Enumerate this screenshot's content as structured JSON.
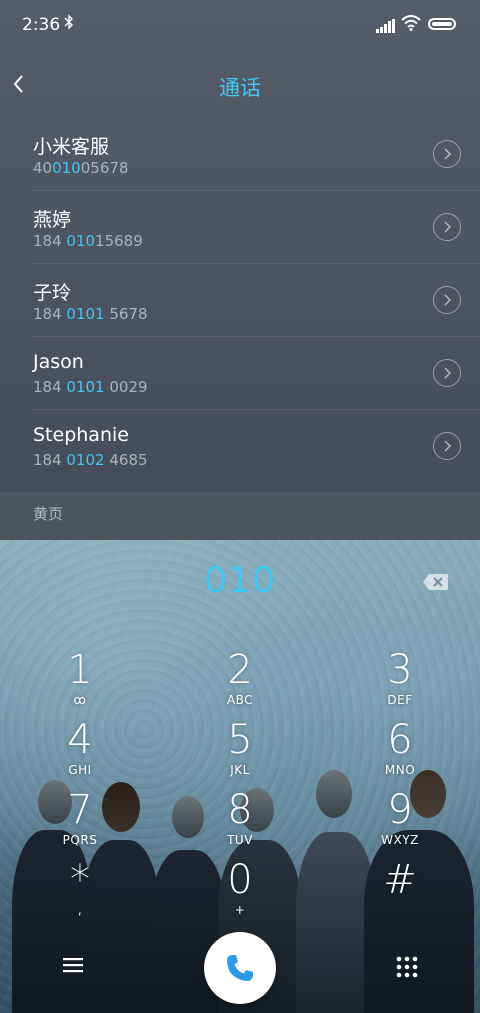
{
  "status": {
    "time": "2:36"
  },
  "header": {
    "title": "通话"
  },
  "contacts": [
    {
      "name": "小米客服",
      "num_pre": "40",
      "num_hl": "010",
      "num_post": "05678"
    },
    {
      "name": "燕婷",
      "num_pre": "184 ",
      "num_hl": "010",
      "num_post": "15689"
    },
    {
      "name": "子玲",
      "num_pre": "184 ",
      "num_hl": "0101",
      "num_post": " 5678"
    },
    {
      "name": "Jason",
      "num_pre": "184 ",
      "num_hl": "0101",
      "num_post": " 0029"
    },
    {
      "name": "Stephanie",
      "num_pre": "184 ",
      "num_hl": "0102",
      "num_post": " 4685"
    }
  ],
  "section": {
    "yellow_pages": "黄页"
  },
  "dialer": {
    "entered": "010",
    "keys": [
      {
        "digit": "1",
        "letters": "ꝏ"
      },
      {
        "digit": "2",
        "letters": "ABC"
      },
      {
        "digit": "3",
        "letters": "DEF"
      },
      {
        "digit": "4",
        "letters": "GHI"
      },
      {
        "digit": "5",
        "letters": "JKL"
      },
      {
        "digit": "6",
        "letters": "MNO"
      },
      {
        "digit": "7",
        "letters": "PQRS"
      },
      {
        "digit": "8",
        "letters": "TUV"
      },
      {
        "digit": "9",
        "letters": "WXYZ"
      },
      {
        "digit": "*",
        "letters": ","
      },
      {
        "digit": "0",
        "letters": "+"
      },
      {
        "digit": "#",
        "letters": ""
      }
    ]
  },
  "colors": {
    "accent": "#40c8f6",
    "call_icon": "#2f9be8"
  },
  "icons": {
    "back": "chevron-left-icon",
    "go": "chevron-right-circle-icon",
    "backspace": "backspace-icon",
    "menu": "menu-icon",
    "call": "phone-icon",
    "keypad": "keypad-icon"
  }
}
